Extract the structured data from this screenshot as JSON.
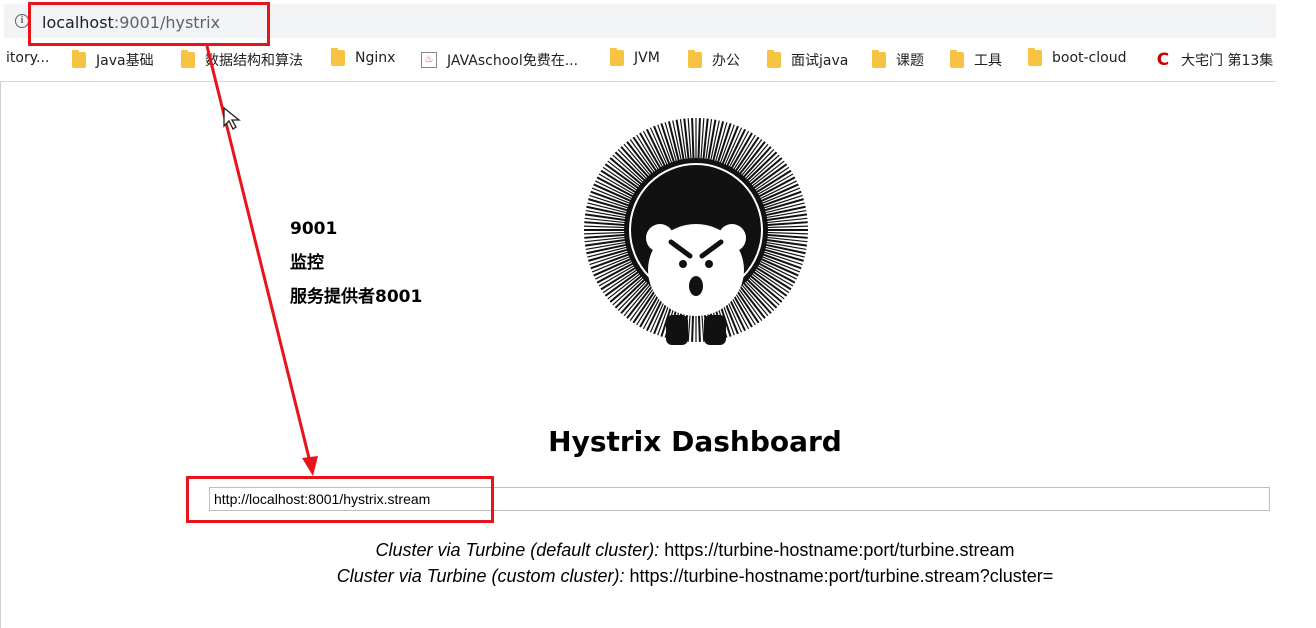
{
  "browser": {
    "url_host": "localhost",
    "url_rest": ":9001/hystrix",
    "bookmarks": [
      {
        "label": "itory...",
        "icon": "none"
      },
      {
        "label": "Java基础",
        "icon": "folder-icon"
      },
      {
        "label": "数据结构和算法",
        "icon": "folder-icon"
      },
      {
        "label": "Nginx",
        "icon": "folder-icon"
      },
      {
        "label": "JAVAschool免费在...",
        "icon": "java-icon"
      },
      {
        "label": "JVM",
        "icon": "folder-icon"
      },
      {
        "label": "办公",
        "icon": "folder-icon"
      },
      {
        "label": "面试java",
        "icon": "folder-icon"
      },
      {
        "label": "课题",
        "icon": "folder-icon"
      },
      {
        "label": "工具",
        "icon": "folder-icon"
      },
      {
        "label": "boot-cloud",
        "icon": "folder-icon"
      },
      {
        "label": "大宅门 第13集",
        "icon": "c-icon"
      }
    ]
  },
  "annotation": {
    "line1": "9001",
    "line2": "监控",
    "line3": "服务提供者8001",
    "color": "#e8131b"
  },
  "dashboard": {
    "title": "Hystrix Dashboard",
    "stream_value": "http://localhost:8001/hystrix.stream",
    "cluster_default_label": "Cluster via Turbine (default cluster):",
    "cluster_default_url": " https://turbine-hostname:port/turbine.stream",
    "cluster_custom_label": "Cluster via Turbine (custom cluster):",
    "cluster_custom_url": " https://turbine-hostname:port/turbine.stream?cluster="
  }
}
